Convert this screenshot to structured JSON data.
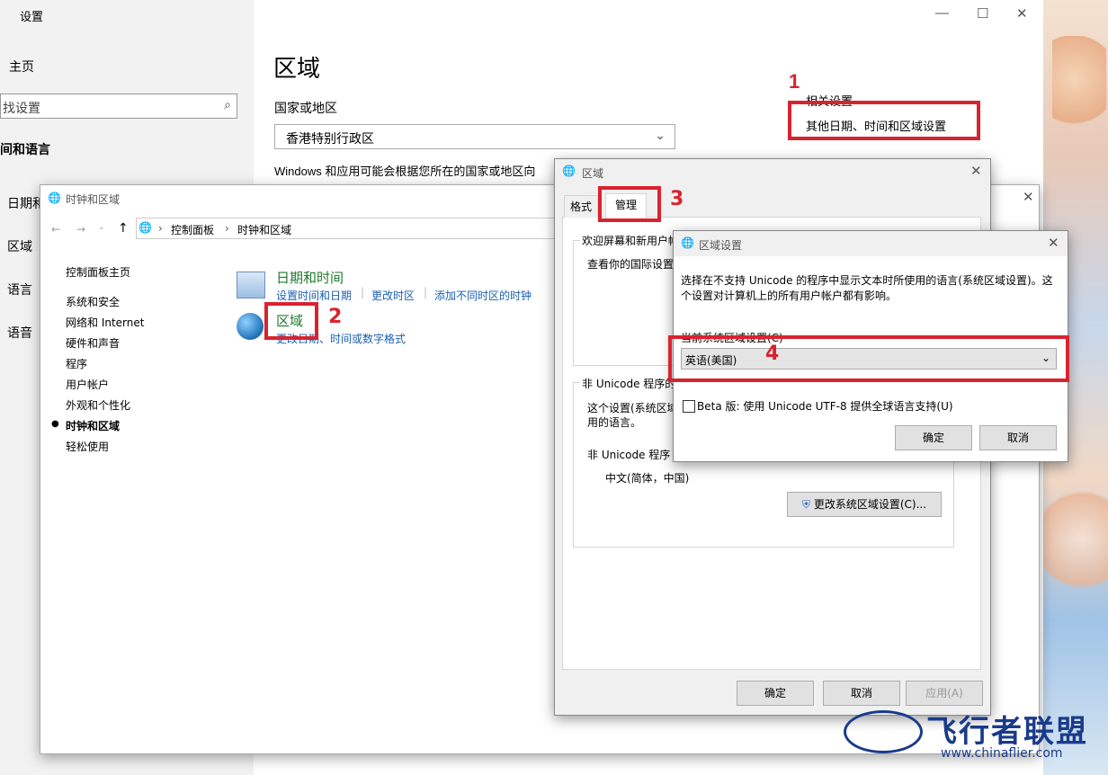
{
  "settings": {
    "title": "设置",
    "home": "主页",
    "search_placeholder": "找设置",
    "section": "间和语言",
    "nav": [
      "日期和",
      "区域",
      "语言",
      "语音"
    ],
    "page_title": "区域",
    "country_label": "国家或地区",
    "country_value": "香港特别行政区",
    "note": "Windows 和应用可能会根据您所在的国家或地区向",
    "related_title": "相关设置",
    "related_link": "其他日期、时间和区域设置"
  },
  "cpanel": {
    "title": "时钟和区域",
    "breadcrumb": [
      "控制面板",
      "时钟和区域"
    ],
    "sidebar": [
      "控制面板主页",
      "系统和安全",
      "网络和 Internet",
      "硬件和声音",
      "程序",
      "用户帐户",
      "外观和个性化",
      "时钟和区域",
      "轻松使用"
    ],
    "datetime": {
      "title": "日期和时间",
      "links": [
        "设置时间和日期",
        "更改时区",
        "添加不同时区的时钟"
      ]
    },
    "region": {
      "title": "区域",
      "link": "更改日期、时间或数字格式"
    }
  },
  "region_dialog": {
    "title": "区域",
    "tabs": [
      "格式",
      "管理"
    ],
    "welcome_title": "欢迎屏幕和新用户帐",
    "welcome_text": "查看你的国际设置",
    "nonunicode_title": "非 Unicode 程序的",
    "nonunicode_text1": "这个设置(系统区域",
    "nonunicode_text2": "用的语言。",
    "current_label": "非 Unicode 程序",
    "current_value": "中文(简体，中国)",
    "change_button": "更改系统区域设置(C)...",
    "ok": "确定",
    "cancel": "取消",
    "apply": "应用(A)"
  },
  "rs_dialog": {
    "title": "区域设置",
    "desc1": "选择在不支持 Unicode 的程序中显示文本时所使用的语言(系统区域设置)。这",
    "desc2": "个设置对计算机上的所有用户帐户都有影响。",
    "current_label": "当前系统区域设置(C)",
    "locale_value": "英语(美国)",
    "beta_label": "Beta 版: 使用 Unicode UTF-8 提供全球语言支持(U)",
    "ok": "确定",
    "cancel": "取消"
  },
  "annotations": [
    "1",
    "2",
    "3",
    "4"
  ],
  "watermark": {
    "text": "飞行者联盟",
    "url": "www.chinaflier.com"
  },
  "colors": {
    "highlight_red": "#d9232e",
    "link_blue": "#1a5fb4",
    "head_green": "#1e7a2c"
  }
}
